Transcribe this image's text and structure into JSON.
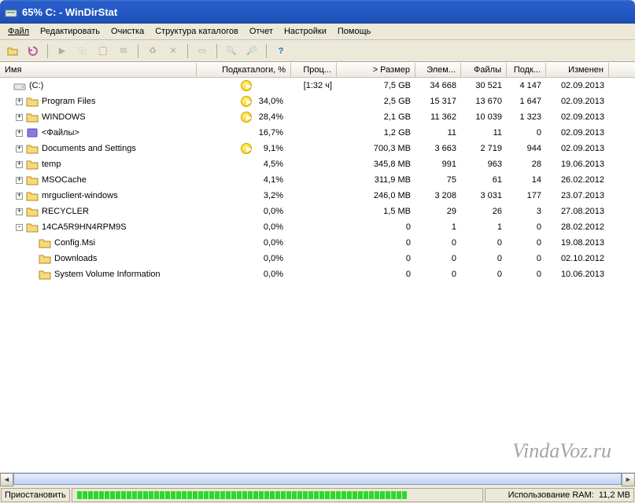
{
  "title": "65% C: - WinDirStat",
  "menu": {
    "file": "Файл",
    "edit": "Редактировать",
    "cleanup": "Очистка",
    "structure": "Структура каталогов",
    "report": "Отчет",
    "settings": "Настройки",
    "help": "Помощь"
  },
  "columns": {
    "name": "Имя",
    "subdirs_pct": "Подкаталоги, %",
    "proc": "Проц...",
    "size": "> Размер",
    "elem": "Элем...",
    "files": "Файлы",
    "subd": "Подк...",
    "modified": "Изменен"
  },
  "rows": [
    {
      "indent": 0,
      "toggle": "",
      "icon": "drive",
      "name": "(C:)",
      "pac": true,
      "pct": "",
      "proc": "[1:32 ч]",
      "size": "7,5 GB",
      "elem": "34 668",
      "files": "30 521",
      "subd": "4 147",
      "mod": "02.09.2013"
    },
    {
      "indent": 1,
      "toggle": "+",
      "icon": "folder",
      "name": "Program Files",
      "pac": true,
      "pct": "34,0%",
      "proc": "",
      "size": "2,5 GB",
      "elem": "15 317",
      "files": "13 670",
      "subd": "1 647",
      "mod": "02.09.2013"
    },
    {
      "indent": 1,
      "toggle": "+",
      "icon": "folder",
      "name": "WINDOWS",
      "pac": true,
      "pct": "28,4%",
      "proc": "",
      "size": "2,1 GB",
      "elem": "11 362",
      "files": "10 039",
      "subd": "1 323",
      "mod": "02.09.2013"
    },
    {
      "indent": 1,
      "toggle": "+",
      "icon": "special",
      "name": "<Файлы>",
      "pac": false,
      "pct": "16,7%",
      "proc": "",
      "size": "1,2 GB",
      "elem": "11",
      "files": "11",
      "subd": "0",
      "mod": "02.09.2013"
    },
    {
      "indent": 1,
      "toggle": "+",
      "icon": "folder",
      "name": "Documents and Settings",
      "pac": true,
      "pct": "9,1%",
      "proc": "",
      "size": "700,3 MB",
      "elem": "3 663",
      "files": "2 719",
      "subd": "944",
      "mod": "02.09.2013"
    },
    {
      "indent": 1,
      "toggle": "+",
      "icon": "folder",
      "name": "temp",
      "pac": false,
      "pct": "4,5%",
      "proc": "",
      "size": "345,8 MB",
      "elem": "991",
      "files": "963",
      "subd": "28",
      "mod": "19.06.2013"
    },
    {
      "indent": 1,
      "toggle": "+",
      "icon": "folder",
      "name": "MSOCache",
      "pac": false,
      "pct": "4,1%",
      "proc": "",
      "size": "311,9 MB",
      "elem": "75",
      "files": "61",
      "subd": "14",
      "mod": "26.02.2012"
    },
    {
      "indent": 1,
      "toggle": "+",
      "icon": "folder",
      "name": "mrguclient-windows",
      "pac": false,
      "pct": "3,2%",
      "proc": "",
      "size": "246,0 MB",
      "elem": "3 208",
      "files": "3 031",
      "subd": "177",
      "mod": "23.07.2013"
    },
    {
      "indent": 1,
      "toggle": "+",
      "icon": "folder",
      "name": "RECYCLER",
      "pac": false,
      "pct": "0,0%",
      "proc": "",
      "size": "1,5 MB",
      "elem": "29",
      "files": "26",
      "subd": "3",
      "mod": "27.08.2013"
    },
    {
      "indent": 1,
      "toggle": "-",
      "icon": "folder",
      "name": "14CA5R9HN4RPM9S",
      "pac": false,
      "pct": "0,0%",
      "proc": "",
      "size": "0",
      "elem": "1",
      "files": "1",
      "subd": "0",
      "mod": "28.02.2012"
    },
    {
      "indent": 2,
      "toggle": "",
      "icon": "folder",
      "name": "Config.Msi",
      "pac": false,
      "pct": "0,0%",
      "proc": "",
      "size": "0",
      "elem": "0",
      "files": "0",
      "subd": "0",
      "mod": "19.08.2013"
    },
    {
      "indent": 2,
      "toggle": "",
      "icon": "folder",
      "name": "Downloads",
      "pac": false,
      "pct": "0,0%",
      "proc": "",
      "size": "0",
      "elem": "0",
      "files": "0",
      "subd": "0",
      "mod": "02.10.2012"
    },
    {
      "indent": 2,
      "toggle": "",
      "icon": "folder",
      "name": "System Volume Information",
      "pac": false,
      "pct": "0,0%",
      "proc": "",
      "size": "0",
      "elem": "0",
      "files": "0",
      "subd": "0",
      "mod": "10.06.2013"
    }
  ],
  "watermark": "VindaVoz.ru",
  "status": {
    "pause": "Приостановить",
    "ram_label": "Использование RAM:",
    "ram_value": "11,2 MB"
  }
}
